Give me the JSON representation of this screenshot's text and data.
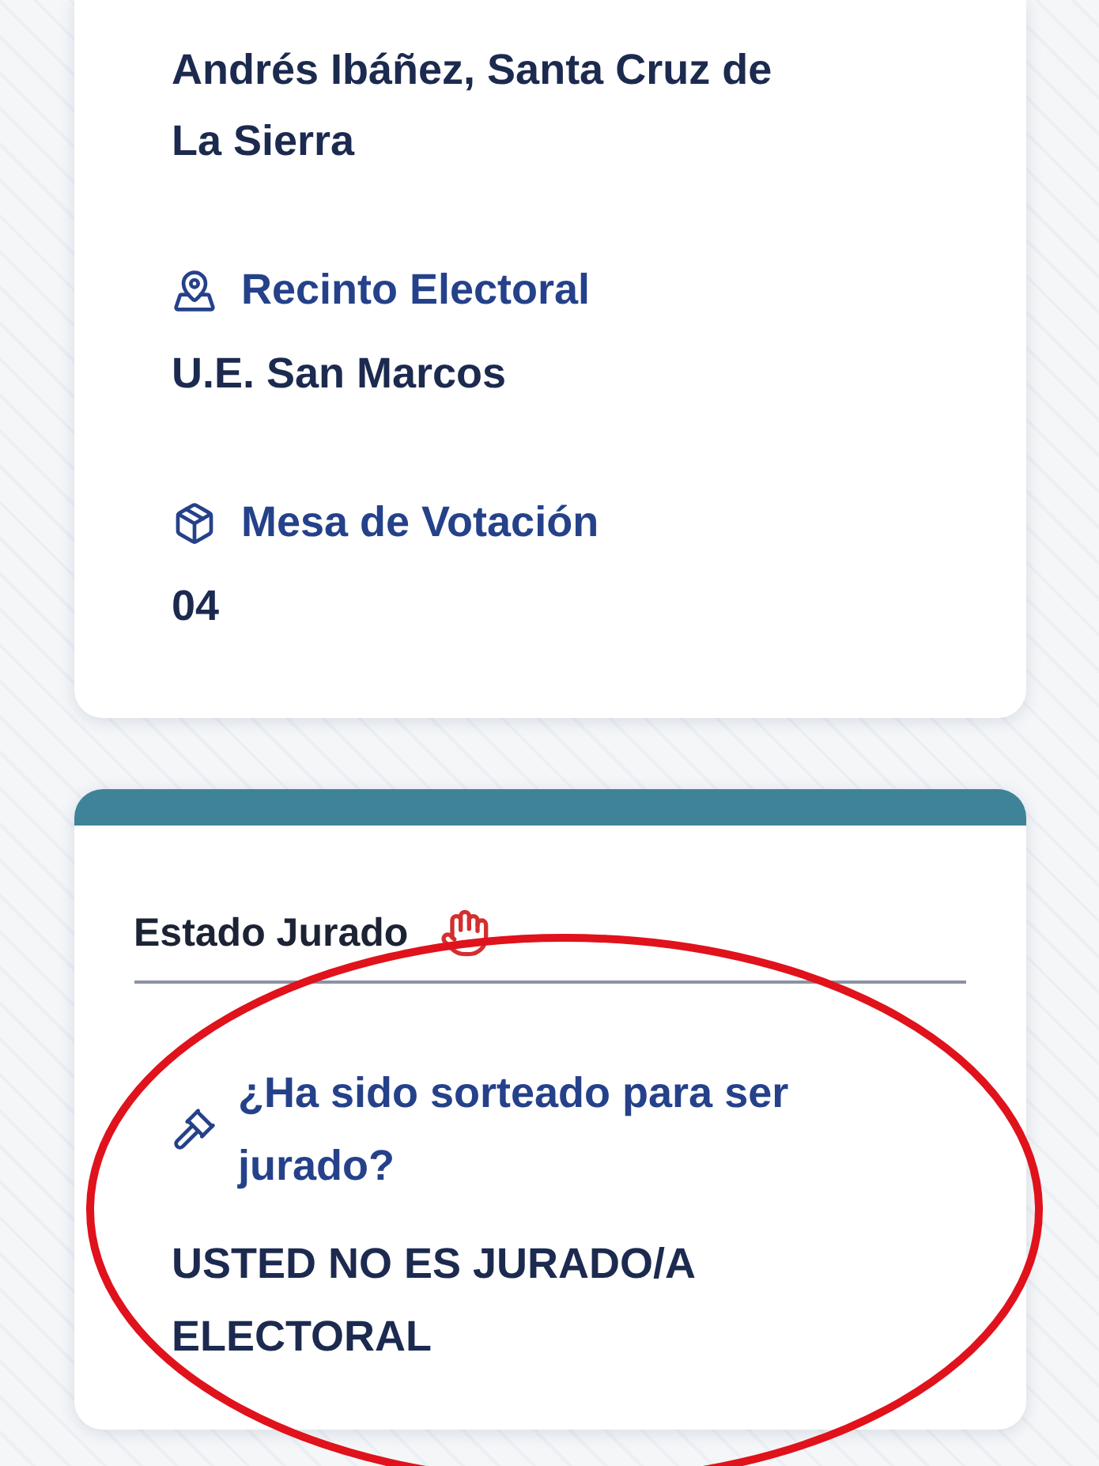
{
  "location_card": {
    "address": "Andrés Ibáñez, Santa Cruz de La Sierra",
    "fields": [
      {
        "kind": "place",
        "label": "Recinto Electoral",
        "value": "U.E. San Marcos"
      },
      {
        "kind": "table",
        "label": "Mesa de Votación",
        "value": "04"
      }
    ]
  },
  "jury_card": {
    "title": "Estado Jurado",
    "question": "¿Ha sido sorteado para ser jurado?",
    "answer": "USTED NO ES JURADO/A ELECTORAL"
  },
  "annotation": {
    "kind": "ellipse"
  }
}
